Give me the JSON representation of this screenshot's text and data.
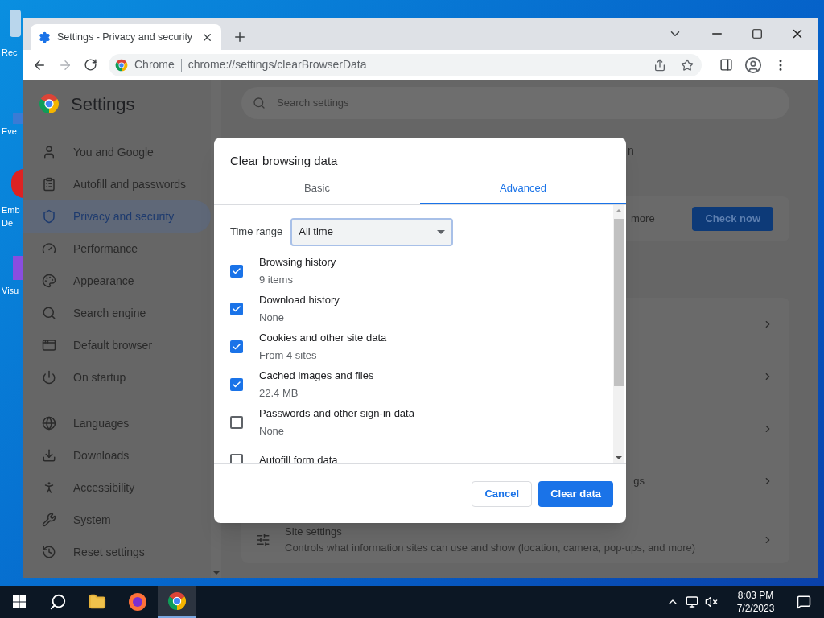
{
  "desktop_icons": [
    {
      "label": "Rec"
    },
    {
      "label": "Eve"
    },
    {
      "label": "Emb"
    },
    {
      "label": "De"
    },
    {
      "label": "Visu"
    }
  ],
  "browser": {
    "tabs": [
      {
        "title": "Settings - Privacy and security",
        "selected": true
      }
    ],
    "address": {
      "site_label": "Chrome",
      "url": "chrome://settings/clearBrowserData"
    }
  },
  "settings": {
    "title": "Settings",
    "search": {
      "placeholder": "Search settings"
    },
    "sidebar": {
      "groups": [
        [
          {
            "label": "You and Google",
            "selected": false
          },
          {
            "label": "Autofill and passwords",
            "selected": false
          },
          {
            "label": "Privacy and security",
            "selected": true
          },
          {
            "label": "Performance",
            "selected": false
          },
          {
            "label": "Appearance",
            "selected": false
          },
          {
            "label": "Search engine",
            "selected": false
          },
          {
            "label": "Default browser",
            "selected": false
          },
          {
            "label": "On startup",
            "selected": false
          }
        ],
        [
          {
            "label": "Languages",
            "selected": false
          },
          {
            "label": "Downloads",
            "selected": false
          },
          {
            "label": "Accessibility",
            "selected": false
          },
          {
            "label": "System",
            "selected": false
          },
          {
            "label": "Reset settings",
            "selected": false
          }
        ]
      ]
    },
    "background": {
      "fragment_1": "n",
      "fragment_2": "more",
      "check_button": "Check now",
      "fragment_3": "gs",
      "site_settings": {
        "title": "Site settings",
        "description": "Controls what information sites can use and show (location, camera, pop-ups, and more)"
      }
    }
  },
  "dialog": {
    "title": "Clear browsing data",
    "tabs": [
      {
        "label": "Basic",
        "selected": false
      },
      {
        "label": "Advanced",
        "selected": true
      }
    ],
    "time_range": {
      "label": "Time range",
      "value": "All time"
    },
    "items": [
      {
        "label": "Browsing history",
        "detail": "9 items",
        "checked": true
      },
      {
        "label": "Download history",
        "detail": "None",
        "checked": true
      },
      {
        "label": "Cookies and other site data",
        "detail": "From 4 sites",
        "checked": true
      },
      {
        "label": "Cached images and files",
        "detail": "22.4 MB",
        "checked": true
      },
      {
        "label": "Passwords and other sign-in data",
        "detail": "None",
        "checked": false
      },
      {
        "label": "Autofill form data",
        "checked": false
      }
    ],
    "buttons": {
      "cancel": "Cancel",
      "confirm": "Clear data"
    }
  },
  "taskbar": {
    "time": "8:03 PM",
    "date": "7/2/2023"
  }
}
